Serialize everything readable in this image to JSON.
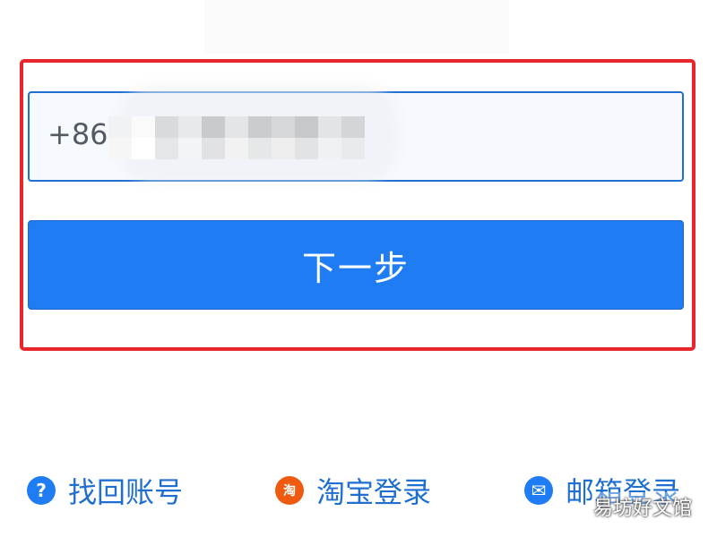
{
  "login": {
    "phone_field": {
      "country_code": "+86",
      "value": ""
    },
    "next_button_label": "下一步"
  },
  "links": {
    "find_account": {
      "icon_name": "question-circle-icon",
      "icon_glyph": "?",
      "label": "找回账号"
    },
    "taobao_login": {
      "icon_name": "taobao-icon",
      "icon_glyph": "淘",
      "label": "淘宝登录"
    },
    "email_login": {
      "icon_name": "mail-icon",
      "icon_glyph": "✉",
      "label": "邮箱登录"
    }
  },
  "watermark_text": "易坊好文馆",
  "colors": {
    "primary": "#1f7cf2",
    "link_text": "#1f6fd1",
    "highlight_border": "#e8262b",
    "taobao_orange": "#f05a10"
  }
}
